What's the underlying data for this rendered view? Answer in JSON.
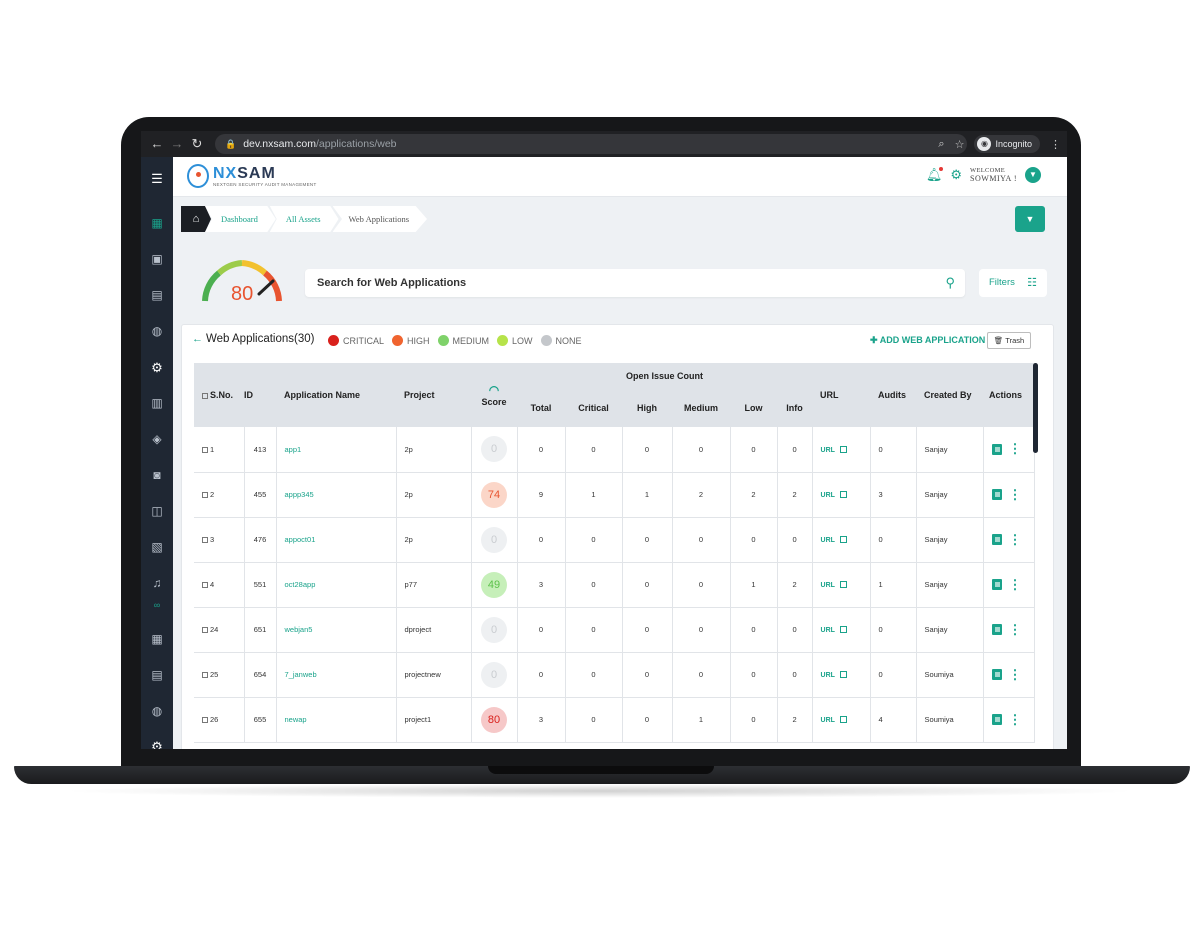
{
  "browser": {
    "url_host": "dev.nxsam.com",
    "url_path": "/applications/web",
    "incognito_label": "Incognito"
  },
  "brand": {
    "name_left": "NX",
    "name_right": "SAM",
    "tagline": "NEXTGEN SECURITY AUDIT MANAGEMENT"
  },
  "header": {
    "welcome_label": "WELCOME",
    "user_name": "SOWMIYA !"
  },
  "breadcrumb": {
    "items": [
      "Dashboard",
      "All Assets",
      "Web Applications"
    ]
  },
  "gauge": {
    "value": "80"
  },
  "search": {
    "placeholder": "Search for Web Applications"
  },
  "filters": {
    "label": "Filters"
  },
  "panel": {
    "title": "Web Applications(30)",
    "add_label": "ADD WEB APPLICATION",
    "trash_label": "Trash",
    "legend": [
      {
        "label": "CRITICAL",
        "color": "#d9211c"
      },
      {
        "label": "HIGH",
        "color": "#f0642f"
      },
      {
        "label": "MEDIUM",
        "color": "#7fd26a"
      },
      {
        "label": "LOW",
        "color": "#b6e34a"
      },
      {
        "label": "NONE",
        "color": "#c4c7cb"
      }
    ]
  },
  "table": {
    "headers": {
      "sno": "S.No.",
      "id": "ID",
      "app_name": "Application Name",
      "project": "Project",
      "score": "Score",
      "open_issue": "Open Issue Count",
      "total": "Total",
      "critical": "Critical",
      "high": "High",
      "medium": "Medium",
      "low": "Low",
      "info": "Info",
      "url": "URL",
      "audits": "Audits",
      "created_by": "Created By",
      "actions": "Actions"
    },
    "url_label": "URL",
    "rows": [
      {
        "sno": "1",
        "id": "413",
        "name": "app1",
        "project": "2p",
        "score": "0",
        "score_bg": "#eef0f2",
        "score_fg": "#c9ccd0",
        "total": "0",
        "critical": "0",
        "high": "0",
        "medium": "0",
        "low": "0",
        "info": "0",
        "audits": "0",
        "created_by": "Sanjay"
      },
      {
        "sno": "2",
        "id": "455",
        "name": "appp345",
        "project": "2p",
        "score": "74",
        "score_bg": "#fbd6c8",
        "score_fg": "#e8542f",
        "total": "9",
        "critical": "1",
        "high": "1",
        "medium": "2",
        "low": "2",
        "info": "2",
        "audits": "3",
        "created_by": "Sanjay"
      },
      {
        "sno": "3",
        "id": "476",
        "name": "appoct01",
        "project": "2p",
        "score": "0",
        "score_bg": "#eef0f2",
        "score_fg": "#c9ccd0",
        "total": "0",
        "critical": "0",
        "high": "0",
        "medium": "0",
        "low": "0",
        "info": "0",
        "audits": "0",
        "created_by": "Sanjay"
      },
      {
        "sno": "4",
        "id": "551",
        "name": "oct28app",
        "project": "p77",
        "score": "49",
        "score_bg": "#c6efb9",
        "score_fg": "#5cc24a",
        "total": "3",
        "critical": "0",
        "high": "0",
        "medium": "0",
        "low": "1",
        "info": "2",
        "audits": "1",
        "created_by": "Sanjay"
      },
      {
        "sno": "24",
        "id": "651",
        "name": "webjan5",
        "project": "dproject",
        "score": "0",
        "score_bg": "#eef0f2",
        "score_fg": "#c9ccd0",
        "total": "0",
        "critical": "0",
        "high": "0",
        "medium": "0",
        "low": "0",
        "info": "0",
        "audits": "0",
        "created_by": "Sanjay"
      },
      {
        "sno": "25",
        "id": "654",
        "name": "7_janweb",
        "project": "projectnew",
        "score": "0",
        "score_bg": "#eef0f2",
        "score_fg": "#c9ccd0",
        "total": "0",
        "critical": "0",
        "high": "0",
        "medium": "0",
        "low": "0",
        "info": "0",
        "audits": "0",
        "created_by": "Soumiya"
      },
      {
        "sno": "26",
        "id": "655",
        "name": "newap",
        "project": "project1",
        "score": "80",
        "score_bg": "#f6c8c8",
        "score_fg": "#d9211c",
        "total": "3",
        "critical": "0",
        "high": "0",
        "medium": "1",
        "low": "0",
        "info": "2",
        "audits": "4",
        "created_by": "Soumiya"
      }
    ]
  }
}
